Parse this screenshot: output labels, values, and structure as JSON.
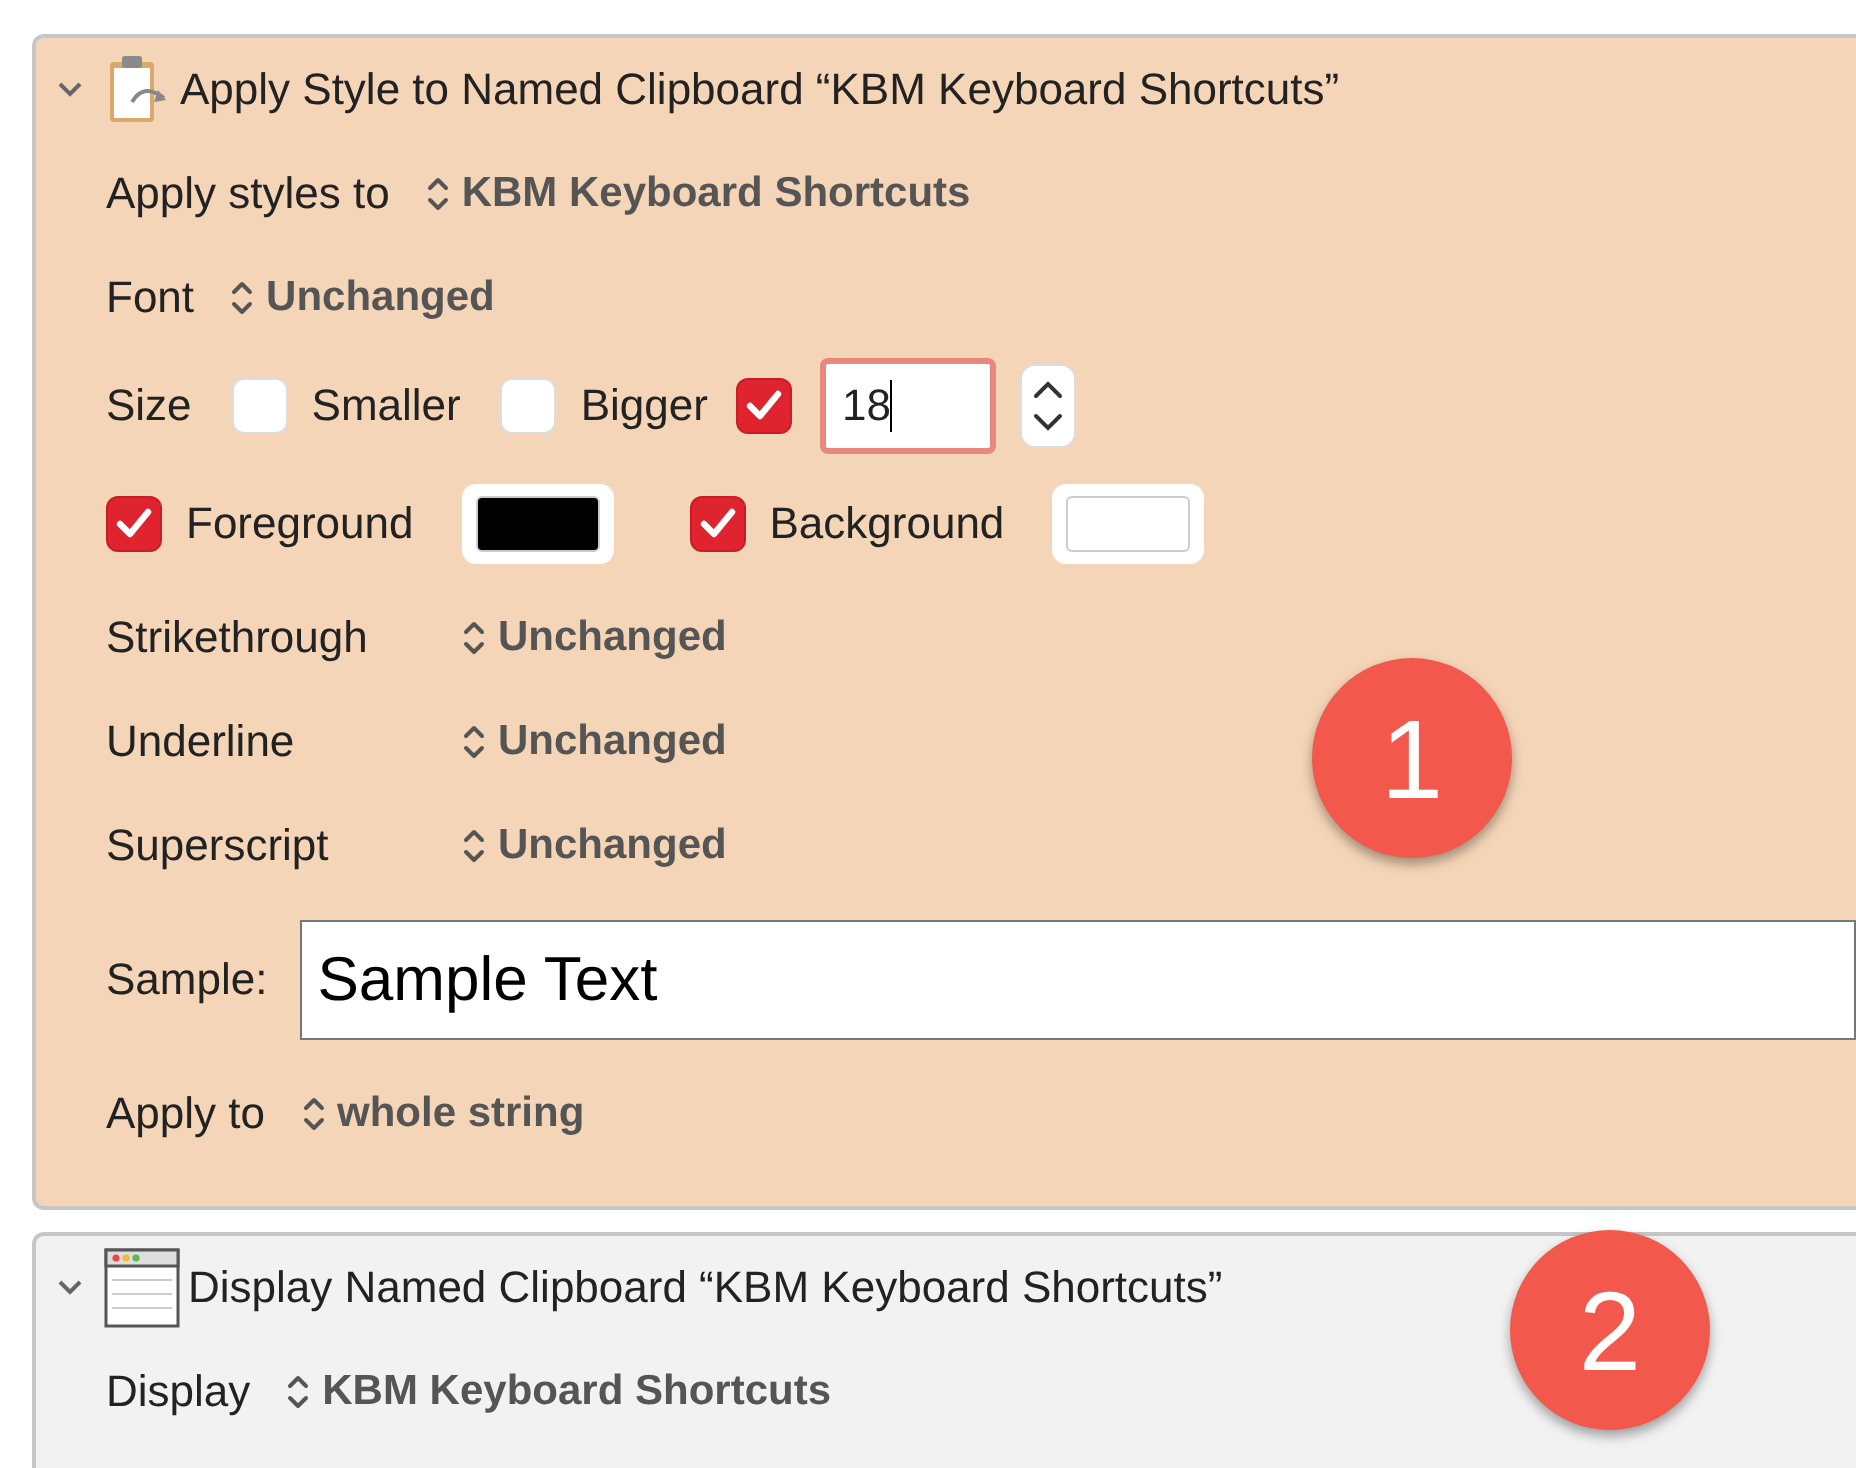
{
  "actions": [
    {
      "kind": "apply_style",
      "expanded": true,
      "title": "Apply Style to Named Clipboard “KBM Keyboard Shortcuts”",
      "badge": "1",
      "rows": [
        {
          "kind": "popup",
          "label": "Apply styles to",
          "value": "KBM Keyboard Shortcuts"
        },
        {
          "kind": "popup",
          "label": "Font",
          "value": "Unchanged"
        },
        {
          "kind": "size",
          "label": "Size",
          "options": [
            {
              "label": "Smaller",
              "checked": false
            },
            {
              "label": "Bigger",
              "checked": false
            }
          ],
          "custom_checked": true,
          "value": "18"
        },
        {
          "kind": "colors",
          "items": [
            {
              "label": "Foreground",
              "checked": true,
              "color": "#000000"
            },
            {
              "label": "Background",
              "checked": true,
              "color": "#ffffff"
            }
          ]
        },
        {
          "kind": "popup_grid",
          "items": [
            {
              "label": "Strikethrough",
              "value": "Unchanged"
            },
            {
              "label": "Underline",
              "value": "Unchanged"
            },
            {
              "label": "Superscript",
              "value": "Unchanged"
            }
          ]
        },
        {
          "kind": "sample",
          "label": "Sample:",
          "value": "Sample Text"
        },
        {
          "kind": "popup",
          "label": "Apply to",
          "value": "whole string"
        }
      ]
    },
    {
      "kind": "display",
      "expanded": true,
      "title": "Display Named Clipboard “KBM Keyboard Shortcuts”",
      "badge": "2",
      "rows": [
        {
          "kind": "popup",
          "label": "Display",
          "value": "KBM Keyboard Shortcuts"
        }
      ]
    }
  ]
}
